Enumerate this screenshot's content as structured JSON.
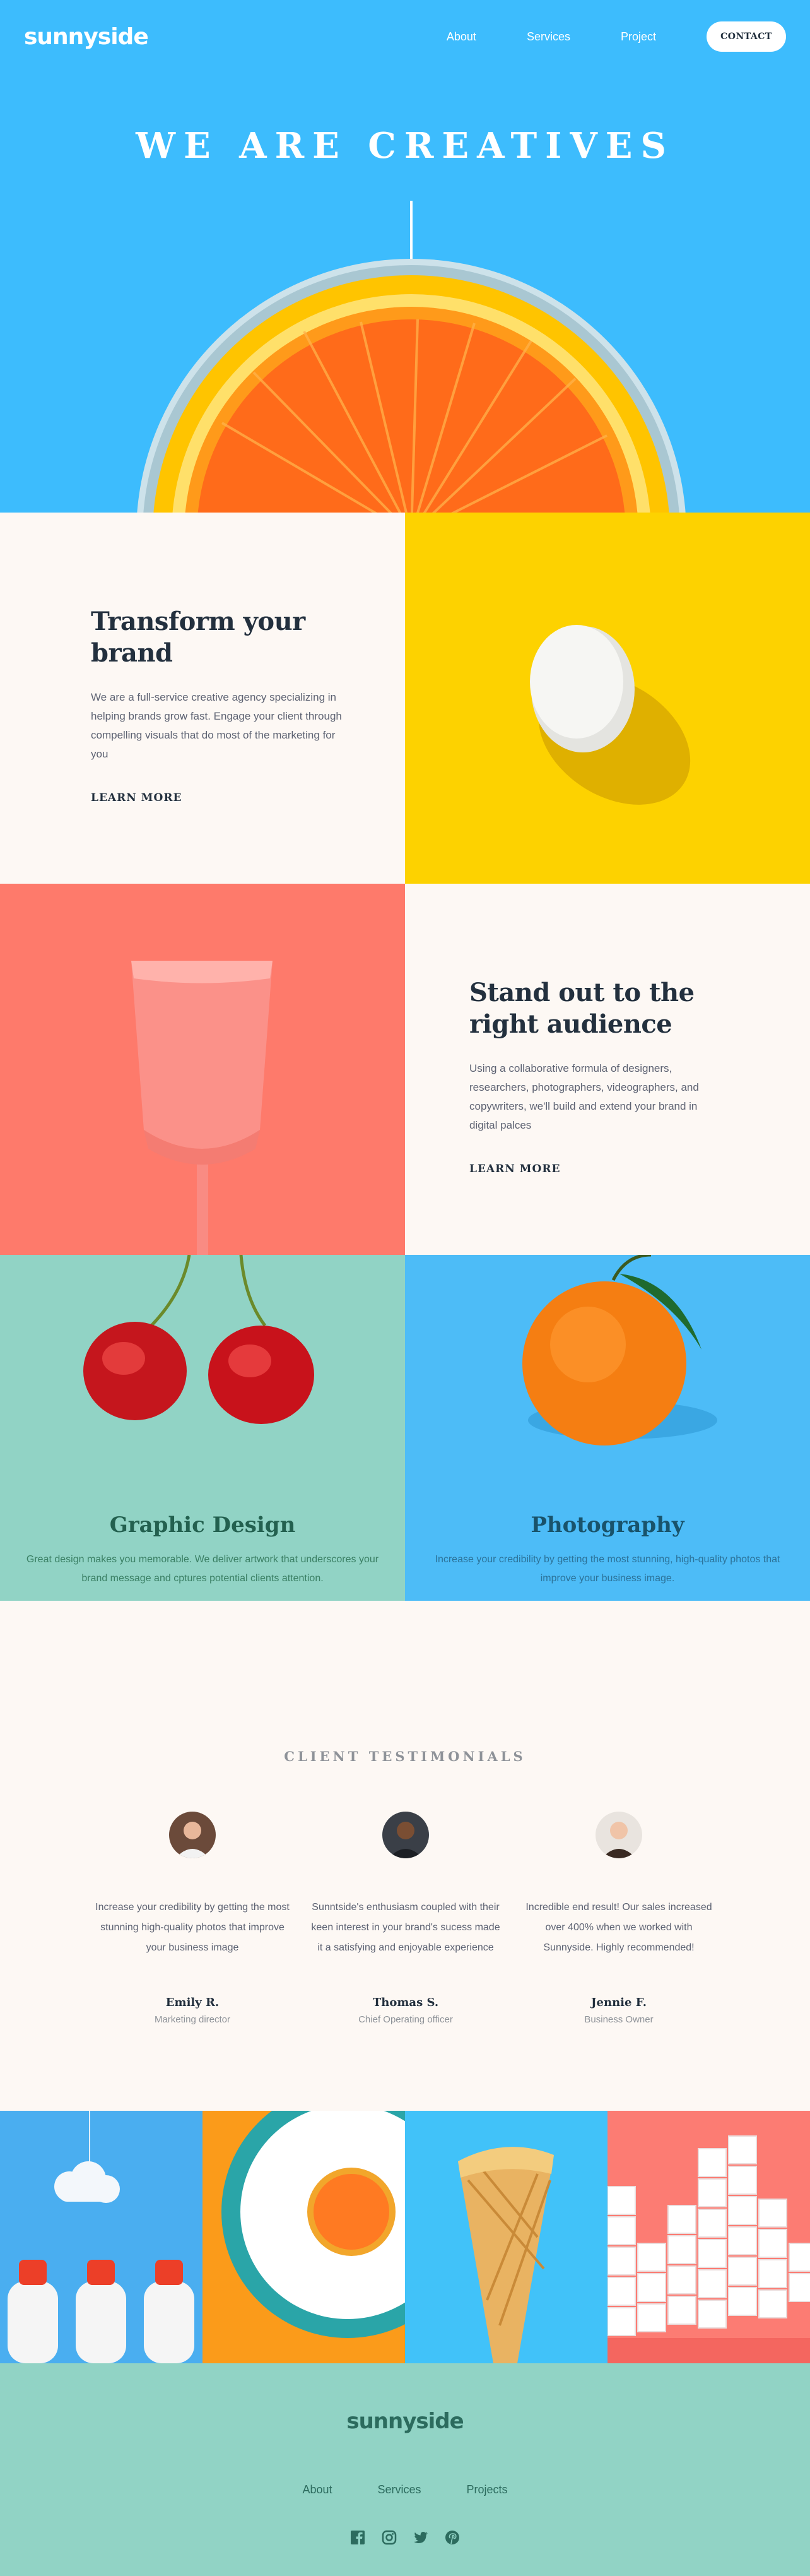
{
  "brand": {
    "logo": "sunnyside"
  },
  "nav": {
    "items": [
      {
        "label": "About"
      },
      {
        "label": "Services"
      },
      {
        "label": "Project"
      }
    ],
    "contact_label": "CONTACT"
  },
  "hero": {
    "title": "WE ARE CREATIVES"
  },
  "features": [
    {
      "title": "Transform your brand",
      "body": "We are a full-service creative agency specializing in helping brands grow fast. Engage your client through compelling visuals that do most of the marketing for you",
      "link": "LEARN MORE"
    },
    {
      "title": "Stand out to the right audience",
      "body": "Using a collaborative formula of designers, researchers, photographers, videographers, and copywriters, we'll build and extend your brand in digital palces",
      "link": "LEARN MORE"
    }
  ],
  "services": [
    {
      "title": "Graphic Design",
      "body": "Great design makes you memorable. We deliver artwork that underscores your brand message and cptures potential clients attention."
    },
    {
      "title": "Photography",
      "body": "Increase your credibility by getting the most stunning, high-quality photos that improve your business image."
    }
  ],
  "testimonials": {
    "heading": "CLIENT TESTIMONIALS",
    "items": [
      {
        "quote": "Increase your credibility by getting the most stunning high-quality photos that improve your business image",
        "name": "Emily R.",
        "role": "Marketing director"
      },
      {
        "quote": "Sunntside's enthusiasm coupled with their keen interest in your brand's sucess made it a satisfying and enjoyable experience",
        "name": "Thomas S.",
        "role": "Chief Operating officer"
      },
      {
        "quote": "Incredible end result! Our sales increased over 400% when we worked with Sunnyside. Highly recommended!",
        "name": "Jennie F.",
        "role": "Business Owner"
      }
    ]
  },
  "footer": {
    "logo": "sunnyside",
    "nav": [
      {
        "label": "About"
      },
      {
        "label": "Services"
      },
      {
        "label": "Projects"
      }
    ],
    "social": [
      "facebook-icon",
      "instagram-icon",
      "twitter-icon",
      "pinterest-icon"
    ]
  },
  "colors": {
    "hero_blue": "#3dbcfd",
    "yellow": "#fad400",
    "pink": "#fe7a6b",
    "green": "#91d3c5",
    "cream": "#fdf8f4",
    "dark": "#23303e"
  }
}
